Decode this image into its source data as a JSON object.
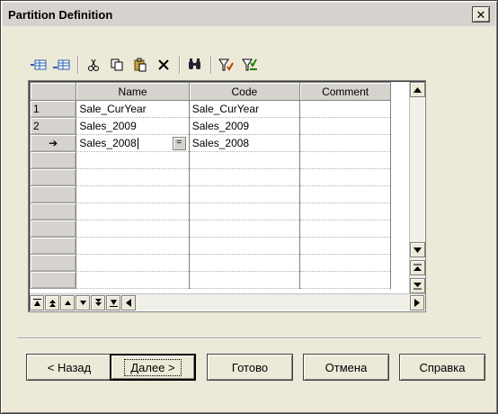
{
  "window": {
    "title": "Partition Definition",
    "close_glyph": "✕"
  },
  "toolbar": {
    "buttons": [
      {
        "name": "add-row-icon"
      },
      {
        "name": "insert-row-icon"
      },
      {
        "name": "cut-icon"
      },
      {
        "name": "copy-icon"
      },
      {
        "name": "paste-icon"
      },
      {
        "name": "delete-icon"
      },
      {
        "name": "find-icon"
      },
      {
        "name": "filter-icon"
      },
      {
        "name": "clear-filter-icon"
      }
    ]
  },
  "grid": {
    "columns": [
      "Name",
      "Code",
      "Comment"
    ],
    "rows": [
      {
        "header": "1",
        "name": "Sale_CurYear",
        "code": "Sale_CurYear",
        "comment": ""
      },
      {
        "header": "2",
        "name": "Sales_2009",
        "code": "Sales_2009",
        "comment": ""
      },
      {
        "header": "➔",
        "name": "Sales_2008",
        "code": "Sales_2008",
        "comment": ""
      }
    ],
    "empty_rows": 8
  },
  "buttons": {
    "back": "< Назад",
    "next": "Далее >",
    "finish": "Готово",
    "cancel": "Отмена",
    "help": "Справка"
  }
}
